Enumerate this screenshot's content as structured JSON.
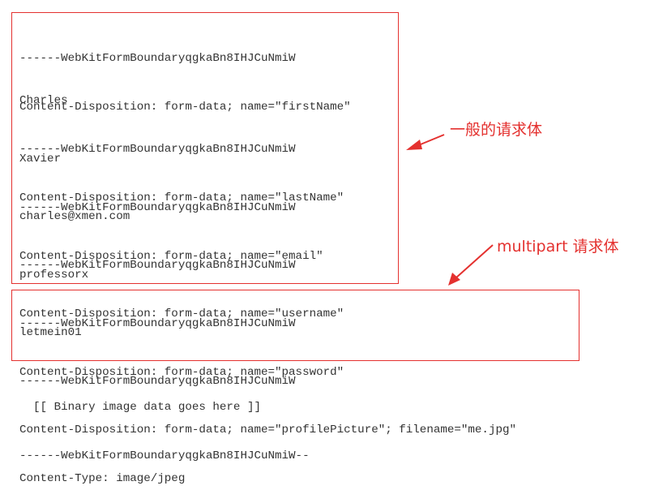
{
  "general_body": {
    "groups": [
      [
        "------WebKitFormBoundaryqgkaBn8IHJCuNmiW",
        "Content-Disposition: form-data; name=\"firstName\""
      ],
      [
        "Charles",
        "------WebKitFormBoundaryqgkaBn8IHJCuNmiW",
        "Content-Disposition: form-data; name=\"lastName\""
      ],
      [
        "Xavier",
        "------WebKitFormBoundaryqgkaBn8IHJCuNmiW",
        "Content-Disposition: form-data; name=\"email\""
      ],
      [
        "charles@xmen.com",
        "------WebKitFormBoundaryqgkaBn8IHJCuNmiW",
        "Content-Disposition: form-data; name=\"username\""
      ],
      [
        "professorx",
        "------WebKitFormBoundaryqgkaBn8IHJCuNmiW",
        "Content-Disposition: form-data; name=\"password\""
      ]
    ]
  },
  "multipart_body": {
    "lines": [
      "letmein01",
      "------WebKitFormBoundaryqgkaBn8IHJCuNmiW",
      "Content-Disposition: form-data; name=\"profilePicture\"; filename=\"me.jpg\"",
      "Content-Type: image/jpeg"
    ]
  },
  "trailer": {
    "binary_placeholder": "  [[ Binary image data goes here ]]",
    "closing_boundary": "------WebKitFormBoundaryqgkaBn8IHJCuNmiW--"
  },
  "annotations": {
    "general_label": "一般的请求体",
    "multipart_label": "multipart 请求体"
  },
  "colors": {
    "accent": "#e4312f",
    "text": "#333333"
  }
}
